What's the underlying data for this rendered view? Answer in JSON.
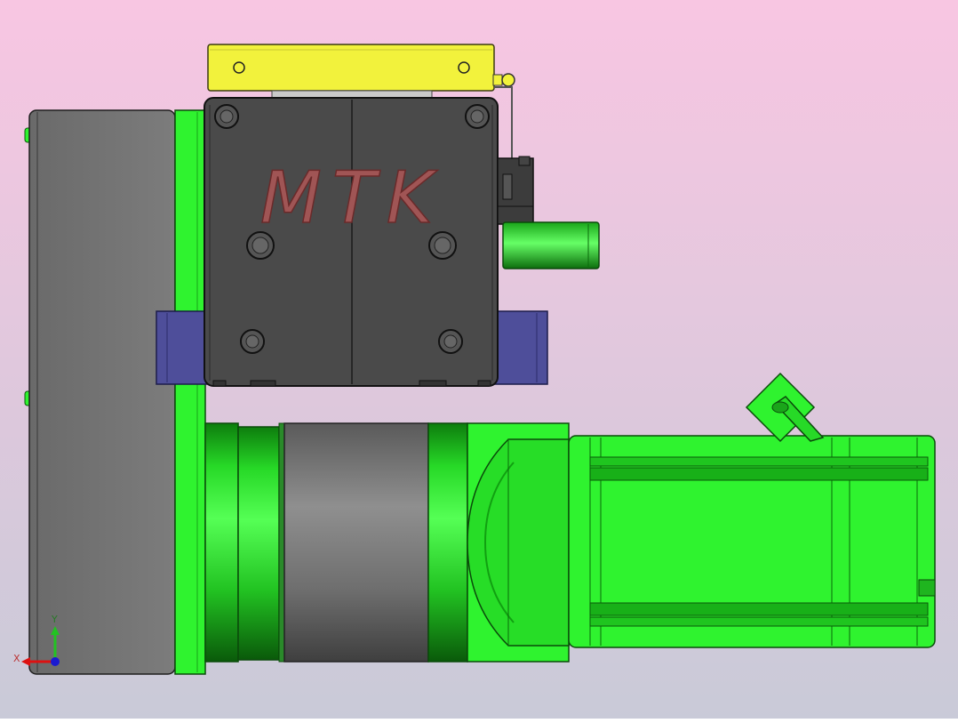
{
  "viewport": {
    "background_top": "#F8C6E2",
    "background_bottom": "#C9CAD8"
  },
  "model": {
    "engraving": "MTK",
    "colors": {
      "green_body": "#2FF32F",
      "green_dark": "#0A7A0A",
      "dark_gray": "#4A4A4A",
      "plate_gray": "#777777",
      "ring_gray": "#8A8A8A",
      "yellow": "#F2F23C",
      "blue": "#4E4E9A",
      "engraving_red": "#A05555"
    }
  },
  "triad": {
    "x_label": "X",
    "y_label": "Y"
  }
}
